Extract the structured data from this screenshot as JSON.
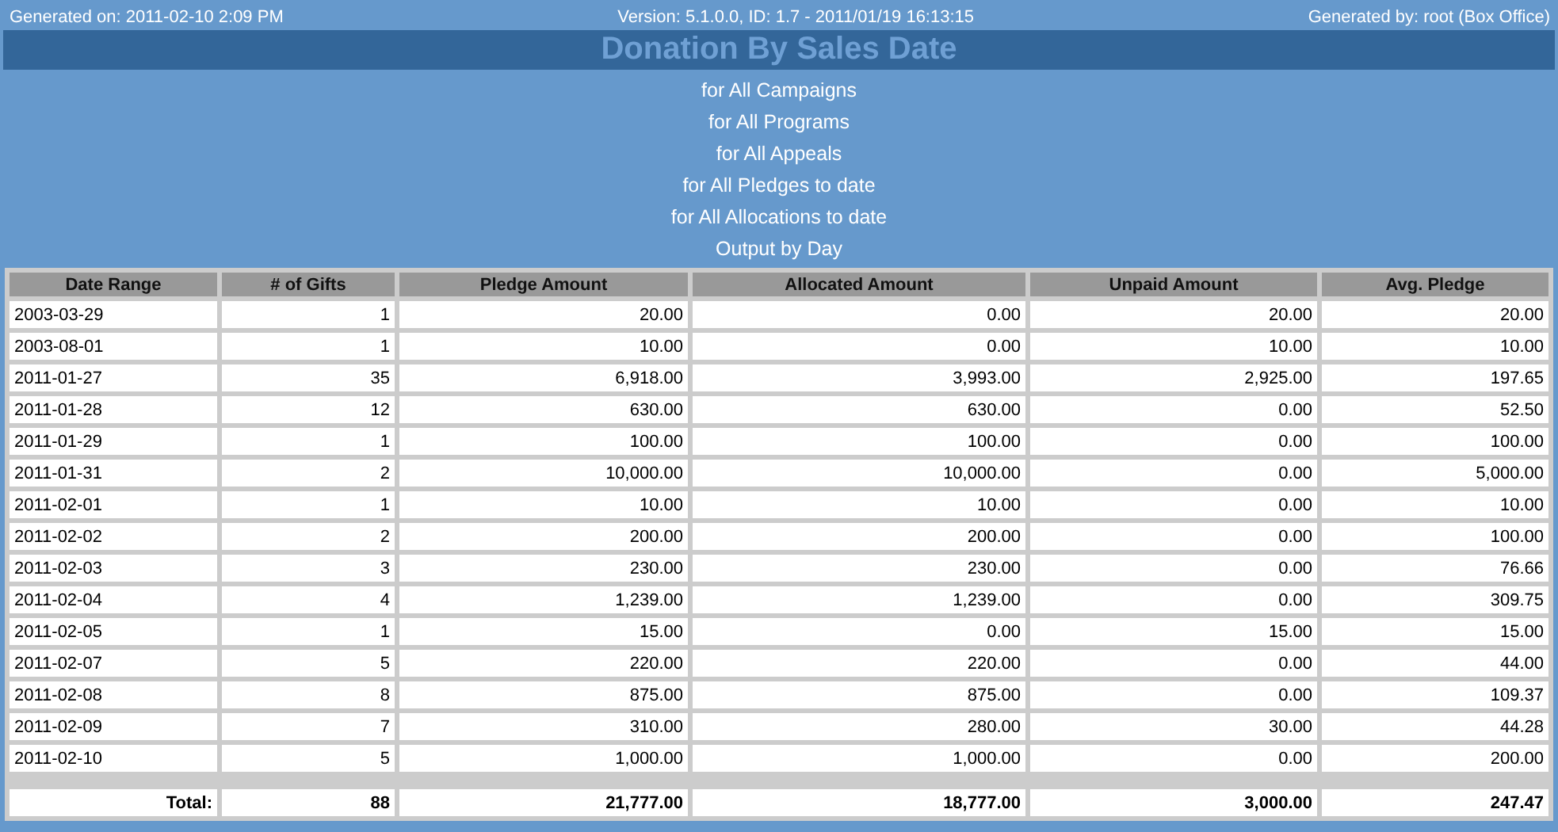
{
  "header": {
    "generated_on": "Generated on: 2011-02-10 2:09 PM",
    "version": "Version: 5.1.0.0, ID: 1.7 - 2011/01/19 16:13:15",
    "generated_by": "Generated by: root (Box Office)"
  },
  "title": "Donation By Sales Date",
  "filters": [
    "for All Campaigns",
    "for All Programs",
    "for All Appeals",
    "for All Pledges to date",
    "for All Allocations to date",
    "Output by Day"
  ],
  "table": {
    "columns": [
      "Date Range",
      "# of Gifts",
      "Pledge Amount",
      "Allocated Amount",
      "Unpaid Amount",
      "Avg. Pledge"
    ],
    "rows": [
      [
        "2003-03-29",
        "1",
        "20.00",
        "0.00",
        "20.00",
        "20.00"
      ],
      [
        "2003-08-01",
        "1",
        "10.00",
        "0.00",
        "10.00",
        "10.00"
      ],
      [
        "2011-01-27",
        "35",
        "6,918.00",
        "3,993.00",
        "2,925.00",
        "197.65"
      ],
      [
        "2011-01-28",
        "12",
        "630.00",
        "630.00",
        "0.00",
        "52.50"
      ],
      [
        "2011-01-29",
        "1",
        "100.00",
        "100.00",
        "0.00",
        "100.00"
      ],
      [
        "2011-01-31",
        "2",
        "10,000.00",
        "10,000.00",
        "0.00",
        "5,000.00"
      ],
      [
        "2011-02-01",
        "1",
        "10.00",
        "10.00",
        "0.00",
        "10.00"
      ],
      [
        "2011-02-02",
        "2",
        "200.00",
        "200.00",
        "0.00",
        "100.00"
      ],
      [
        "2011-02-03",
        "3",
        "230.00",
        "230.00",
        "0.00",
        "76.66"
      ],
      [
        "2011-02-04",
        "4",
        "1,239.00",
        "1,239.00",
        "0.00",
        "309.75"
      ],
      [
        "2011-02-05",
        "1",
        "15.00",
        "0.00",
        "15.00",
        "15.00"
      ],
      [
        "2011-02-07",
        "5",
        "220.00",
        "220.00",
        "0.00",
        "44.00"
      ],
      [
        "2011-02-08",
        "8",
        "875.00",
        "875.00",
        "0.00",
        "109.37"
      ],
      [
        "2011-02-09",
        "7",
        "310.00",
        "280.00",
        "30.00",
        "44.28"
      ],
      [
        "2011-02-10",
        "5",
        "1,000.00",
        "1,000.00",
        "0.00",
        "200.00"
      ]
    ],
    "total": [
      "Total:",
      "88",
      "21,777.00",
      "18,777.00",
      "3,000.00",
      "247.47"
    ]
  }
}
